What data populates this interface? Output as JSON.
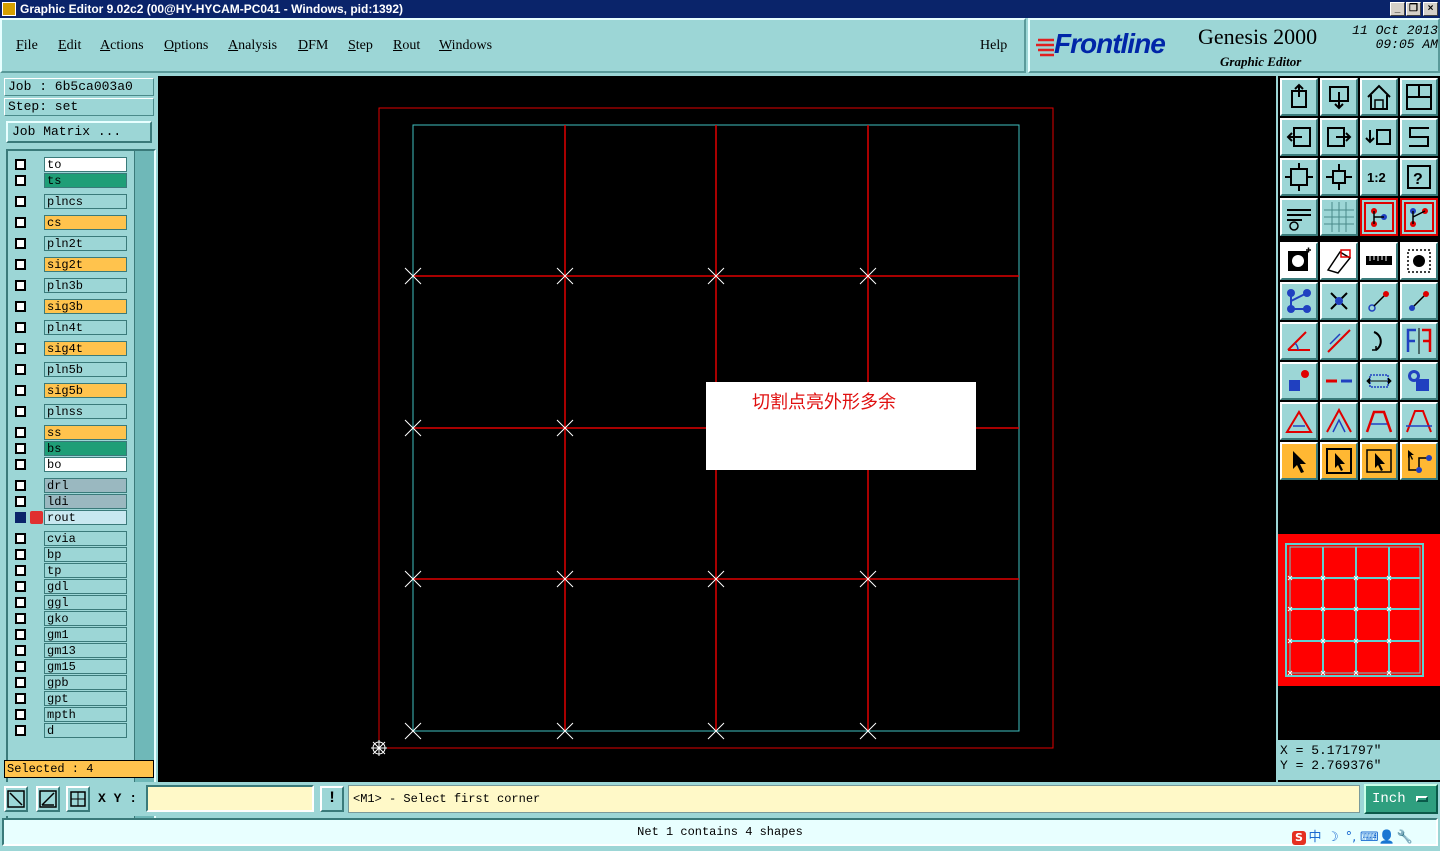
{
  "window": {
    "title": "Graphic Editor 9.02c2 (00@HY-HYCAM-PC041 - Windows, pid:1392)",
    "controls": {
      "minimize": "_",
      "restore": "❐",
      "close": "×"
    }
  },
  "menu": {
    "items": [
      {
        "key": "file",
        "u": "F",
        "rest": "ile"
      },
      {
        "key": "edit",
        "u": "E",
        "rest": "dit"
      },
      {
        "key": "actions",
        "u": "A",
        "rest": "ctions"
      },
      {
        "key": "options",
        "u": "O",
        "rest": "ptions"
      },
      {
        "key": "analysis",
        "u": "A",
        "rest": "nalysis"
      },
      {
        "key": "dfm",
        "u": "D",
        "rest": "FM"
      },
      {
        "key": "step",
        "u": "S",
        "rest": "tep"
      },
      {
        "key": "rout",
        "u": "R",
        "rest": "out"
      },
      {
        "key": "windows",
        "u": "W",
        "rest": "indows"
      }
    ],
    "help": "Help"
  },
  "brand": {
    "logo": "Frontline",
    "product": "Genesis 2000",
    "subtitle": "Graphic Editor",
    "date": "11 Oct 2013",
    "time": "09:05 AM"
  },
  "job": {
    "job_line": "Job : 6b5ca003a0",
    "step_line": "Step: set",
    "matrix_button": "Job Matrix ..."
  },
  "layers": [
    {
      "name": "to",
      "color": "#ffffff"
    },
    {
      "name": "ts",
      "color": "#1f9e77"
    },
    {
      "name": "plncs",
      "color": "#9cd6d6"
    },
    {
      "name": "cs",
      "color": "#ffc34d"
    },
    {
      "name": "pln2t",
      "color": "#9cd6d6"
    },
    {
      "name": "sig2t",
      "color": "#ffc34d"
    },
    {
      "name": "pln3b",
      "color": "#9cd6d6"
    },
    {
      "name": "sig3b",
      "color": "#ffc34d"
    },
    {
      "name": "pln4t",
      "color": "#9cd6d6"
    },
    {
      "name": "sig4t",
      "color": "#ffc34d"
    },
    {
      "name": "pln5b",
      "color": "#9cd6d6"
    },
    {
      "name": "sig5b",
      "color": "#ffc34d"
    },
    {
      "name": "plnss",
      "color": "#9cd6d6"
    },
    {
      "name": "ss",
      "color": "#ffc34d"
    },
    {
      "name": "bs",
      "color": "#1f9e77"
    },
    {
      "name": "bo",
      "color": "#ffffff"
    },
    {
      "name": "drl",
      "color": "#9ab8c0"
    },
    {
      "name": "ldi",
      "color": "#9ab8c0"
    },
    {
      "name": "rout",
      "color": "#c8e8f0"
    },
    {
      "name": "cvia",
      "color": "#9cd6d6"
    },
    {
      "name": "bp",
      "color": "#9cd6d6"
    },
    {
      "name": "tp",
      "color": "#9cd6d6"
    },
    {
      "name": "gdl",
      "color": "#9cd6d6"
    },
    {
      "name": "ggl",
      "color": "#9cd6d6"
    },
    {
      "name": "gko",
      "color": "#9cd6d6"
    },
    {
      "name": "gm1",
      "color": "#9cd6d6"
    },
    {
      "name": "gm13",
      "color": "#9cd6d6"
    },
    {
      "name": "gm15",
      "color": "#9cd6d6"
    },
    {
      "name": "gpb",
      "color": "#9cd6d6"
    },
    {
      "name": "gpt",
      "color": "#9cd6d6"
    },
    {
      "name": "mpth",
      "color": "#9cd6d6"
    },
    {
      "name": "d",
      "color": "#9cd6d6"
    }
  ],
  "selected": "Selected : 4",
  "annotation": "切割点亮外形多余",
  "coords": {
    "x": "X = 5.171797\"",
    "y": "Y = 2.769376\""
  },
  "bottom": {
    "xy_label": "X Y :",
    "xy_value": "",
    "bang": "!",
    "prompt": "<M1> - Select first corner",
    "unit": "Inch"
  },
  "status": "Net 1 contains 4 shapes",
  "colors": {
    "profile": "#e00000",
    "outline": "#40c0c0",
    "cut_line": "#e00000",
    "marker": "#ffffff",
    "preview_fill": "#ff0000",
    "preview_grid": "#60d0d0"
  }
}
